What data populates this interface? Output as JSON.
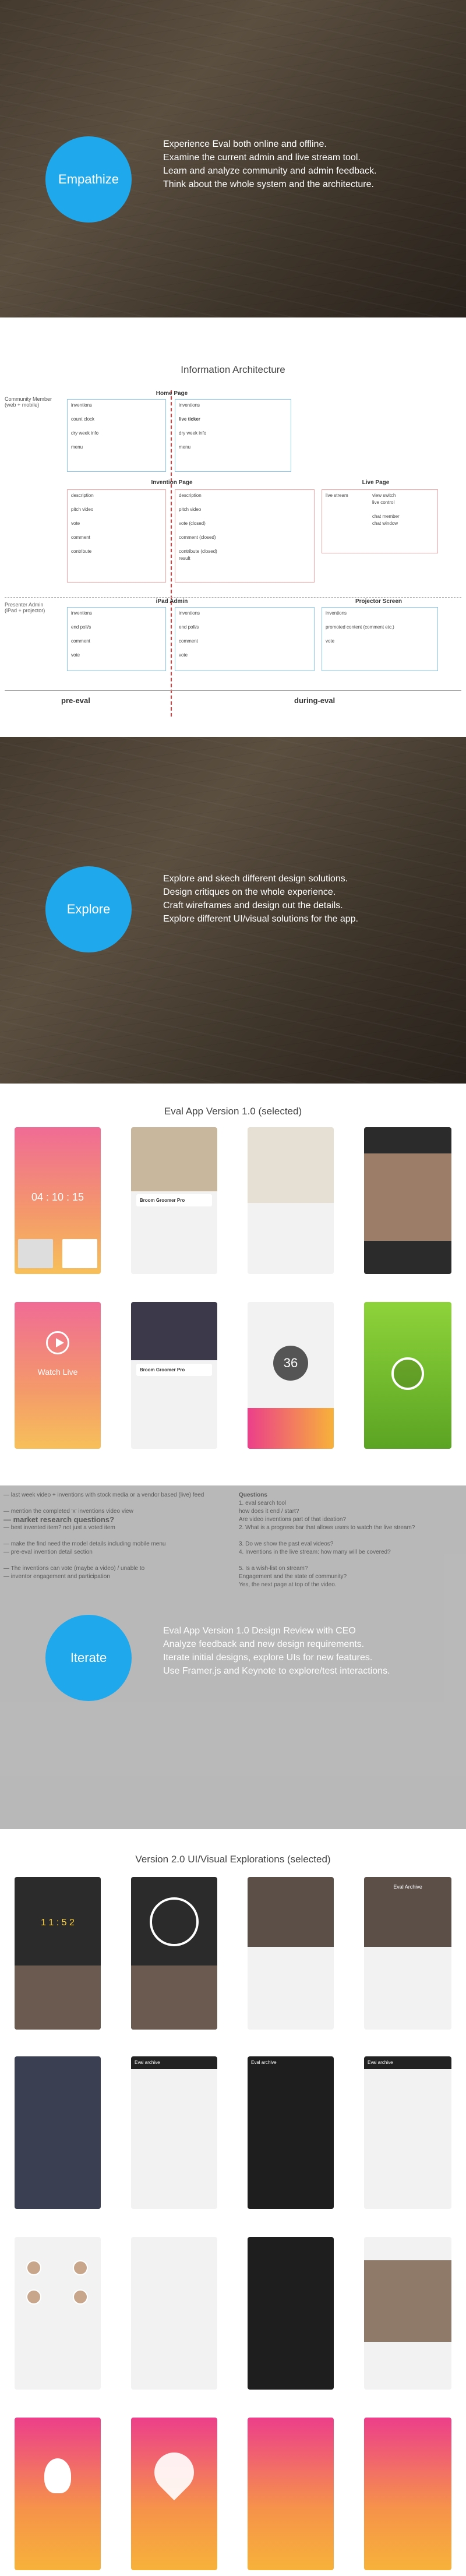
{
  "empathize": {
    "label": "Empathize",
    "bullets": [
      "Experience Eval both online and offline.",
      "Examine the current admin and live stream tool.",
      "Learn and analyze community and admin feedback.",
      "Think about the whole system and the architecture."
    ]
  },
  "ia": {
    "title": "Information Architecture",
    "left_label_1": "Community Member",
    "left_label_1b": "(web + mobile)",
    "left_label_2": "Presenter Admin",
    "left_label_2b": "(iPad + projector)",
    "home_page": "Home Page",
    "home_left": [
      "inventions",
      "count clock",
      "dry week info",
      "menu"
    ],
    "home_right": [
      "inventions",
      "live ticker",
      "dry week info",
      "menu"
    ],
    "invention_page": "Invention Page",
    "inv_left": [
      "description",
      "pitch video",
      "vote",
      "comment",
      "contribute"
    ],
    "inv_right": [
      "description",
      "pitch video",
      "vote (closed)",
      "comment (closed)",
      "contribute (closed)",
      "result"
    ],
    "live_page": "Live Page",
    "live_items": [
      "live stream",
      "view switch",
      "live control",
      "chat member",
      "chat window"
    ],
    "ipad_admin": "iPad Admin",
    "ipad_left": [
      "inventions",
      "end poll/s",
      "comment",
      "vote"
    ],
    "ipad_right": [
      "inventions",
      "end poll/s",
      "comment",
      "vote"
    ],
    "projector": "Projector Screen",
    "proj_items": [
      "inventions",
      "promoted content (comment etc.)",
      "vote"
    ],
    "pre_eval": "pre-eval",
    "during_eval": "during-eval"
  },
  "explore": {
    "label": "Explore",
    "bullets": [
      "Explore and skech different design solutions.",
      "Design critiques on the whole experience.",
      "Craft wireframes and design out the details.",
      "Explore different UI/visual solutions for the app."
    ]
  },
  "eval_v1": {
    "title": "Eval App Version 1.0 (selected)",
    "clock": "04 : 10 : 15",
    "card_title": "Broom Groomer Pro",
    "watch_live": "Watch Live",
    "badge_number": "36"
  },
  "iterate": {
    "label": "Iterate",
    "bullets": [
      "Eval App Version 1.0 Design Review with CEO",
      "Analyze feedback and new design requirements.",
      "Iterate initial designs, explore UIs for new features.",
      "Use Framer.js and Keynote to explore/test interactions."
    ],
    "notes_left": [
      "— last week video + inventions with stock media or a vendor based (live) feed",
      "— mention the completed 'x' inventions video view",
      "— market research questions?",
      "— best invented item? not just a voted item",
      "— make the find need the model details including mobile menu",
      "— pre-eval invention detail section",
      "— The inventions can vote (maybe a video) / unable to",
      "— inventor engagement and participation"
    ],
    "notes_right_title": "Questions",
    "notes_right": [
      "1. eval search tool",
      "how does it end / start?",
      "Are video inventions part of that ideation?",
      "2. What is a progress bar that allows users to watch the live stream?",
      "3. Do we show the past eval videos?",
      "4. Inventions in the live stream: how many will be covered?",
      "5. Is a wish-list on stream?",
      "Engagement and the state of community?",
      "Yes, the next page at top of the video."
    ]
  },
  "v2": {
    "title": "Version 2.0 UI/Visual Explorations (selected)",
    "clock": "1 1 : 5 2",
    "eval_archive": "Eval archive",
    "row1_4_title": "Eval Archive"
  }
}
